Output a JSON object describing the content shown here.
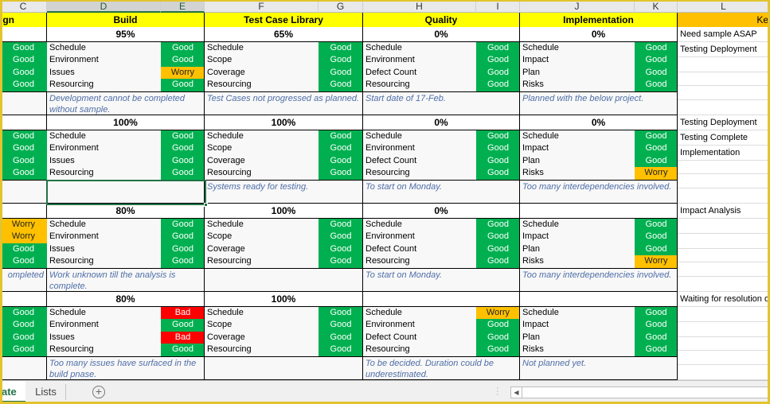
{
  "column_headers": [
    "C",
    "D",
    "E",
    "F",
    "G",
    "H",
    "I",
    "J",
    "K",
    "L"
  ],
  "section_headers": {
    "design_partial": "ign",
    "build": "Build",
    "test_case_library": "Test Case Library",
    "quality": "Quality",
    "implementation": "Implementation",
    "key_partial": "Ke"
  },
  "blocks": [
    {
      "design": {
        "statuses": [
          "Good",
          "Good",
          "Good",
          "Good"
        ],
        "note": ""
      },
      "build": {
        "pct": "95%",
        "labels": [
          "Schedule",
          "Environment",
          "Issues",
          "Resourcing"
        ],
        "statuses": [
          "Good",
          "Good",
          "Worry",
          "Good"
        ],
        "note": "Development cannot be completed without sample."
      },
      "test": {
        "pct": "65%",
        "labels": [
          "Schedule",
          "Scope",
          "Coverage",
          "Resourcing"
        ],
        "statuses": [
          "Good",
          "Good",
          "Good",
          "Good"
        ],
        "note": "Test Cases not progressed as planned."
      },
      "quality": {
        "pct": "0%",
        "labels": [
          "Schedule",
          "Environment",
          "Defect Count",
          "Resourcing"
        ],
        "statuses": [
          "Good",
          "Good",
          "Good",
          "Good"
        ],
        "note": "Start date of 17-Feb."
      },
      "impl": {
        "pct": "0%",
        "labels": [
          "Schedule",
          "Impact",
          "Plan",
          "Risks"
        ],
        "statuses": [
          "Good",
          "Good",
          "Good",
          "Good"
        ],
        "note": "Planned with the below project."
      },
      "key": [
        "Need sample ASAP",
        "Testing Deployment"
      ]
    },
    {
      "design": {
        "statuses": [
          "Good",
          "Good",
          "Good",
          "Good"
        ],
        "note": ""
      },
      "build": {
        "pct": "100%",
        "labels": [
          "Schedule",
          "Environment",
          "Issues",
          "Resourcing"
        ],
        "statuses": [
          "Good",
          "Good",
          "Good",
          "Good"
        ],
        "note": ""
      },
      "test": {
        "pct": "100%",
        "labels": [
          "Schedule",
          "Scope",
          "Coverage",
          "Resourcing"
        ],
        "statuses": [
          "Good",
          "Good",
          "Good",
          "Good"
        ],
        "note": "Systems ready for testing."
      },
      "quality": {
        "pct": "0%",
        "labels": [
          "Schedule",
          "Environment",
          "Defect Count",
          "Resourcing"
        ],
        "statuses": [
          "Good",
          "Good",
          "Good",
          "Good"
        ],
        "note": "To start on Monday."
      },
      "impl": {
        "pct": "0%",
        "labels": [
          "Schedule",
          "Impact",
          "Plan",
          "Risks"
        ],
        "statuses": [
          "Good",
          "Good",
          "Good",
          "Worry"
        ],
        "note": "Too many interdependencies involved."
      },
      "key": [
        "Testing Deployment",
        "Testing Complete",
        "Implementation"
      ]
    },
    {
      "design": {
        "statuses": [
          "Worry",
          "Worry",
          "Good",
          "Good"
        ],
        "note": "ompleted"
      },
      "build": {
        "pct": "80%",
        "labels": [
          "Schedule",
          "Environment",
          "Issues",
          "Resourcing"
        ],
        "statuses": [
          "Good",
          "Good",
          "Good",
          "Good"
        ],
        "note": "Work unknown till the analysis is complete."
      },
      "test": {
        "pct": "100%",
        "labels": [
          "Schedule",
          "Scope",
          "Coverage",
          "Resourcing"
        ],
        "statuses": [
          "Good",
          "Good",
          "Good",
          "Good"
        ],
        "note": ""
      },
      "quality": {
        "pct": "0%",
        "labels": [
          "Schedule",
          "Environment",
          "Defect Count",
          "Resourcing"
        ],
        "statuses": [
          "Good",
          "Good",
          "Good",
          "Good"
        ],
        "note": "To start on Monday."
      },
      "impl": {
        "pct": "",
        "labels": [
          "Schedule",
          "Impact",
          "Plan",
          "Risks"
        ],
        "statuses": [
          "Good",
          "Good",
          "Good",
          "Worry"
        ],
        "note": "Too many interdependencies involved."
      },
      "key": [
        "Impact Analysis"
      ]
    },
    {
      "design": {
        "statuses": [
          "Good",
          "Good",
          "Good",
          "Good"
        ],
        "note": ""
      },
      "build": {
        "pct": "80%",
        "labels": [
          "Schedule",
          "Environment",
          "Issues",
          "Resourcing"
        ],
        "statuses": [
          "Bad",
          "Good",
          "Bad",
          "Good"
        ],
        "note": "Too many issues have surfaced in the build pnase."
      },
      "test": {
        "pct": "100%",
        "labels": [
          "Schedule",
          "Scope",
          "Coverage",
          "Resourcing"
        ],
        "statuses": [
          "Good",
          "Good",
          "Good",
          "Good"
        ],
        "note": ""
      },
      "quality": {
        "pct": "",
        "labels": [
          "Schedule",
          "Environment",
          "Defect Count",
          "Resourcing"
        ],
        "statuses": [
          "Worry",
          "Good",
          "Good",
          "Good"
        ],
        "note": "To be decided. Duration could be underestimated."
      },
      "impl": {
        "pct": "",
        "labels": [
          "Schedule",
          "Impact",
          "Plan",
          "Risks"
        ],
        "statuses": [
          "Good",
          "Good",
          "Good",
          "Good"
        ],
        "note": "Not planned yet."
      },
      "key": [
        "Waiting for resolution o"
      ]
    }
  ],
  "sheet_tabs": [
    {
      "label": "ate",
      "active": true
    },
    {
      "label": "Lists",
      "active": false
    }
  ],
  "add_sheet_icon": "plus-circle-icon",
  "colors": {
    "good": "#00b050",
    "worry": "#ffc000",
    "bad": "#ff0000",
    "header": "#ffff00",
    "key_header": "#ffc000",
    "note_text": "#4f6ea8",
    "accent": "#217346"
  }
}
